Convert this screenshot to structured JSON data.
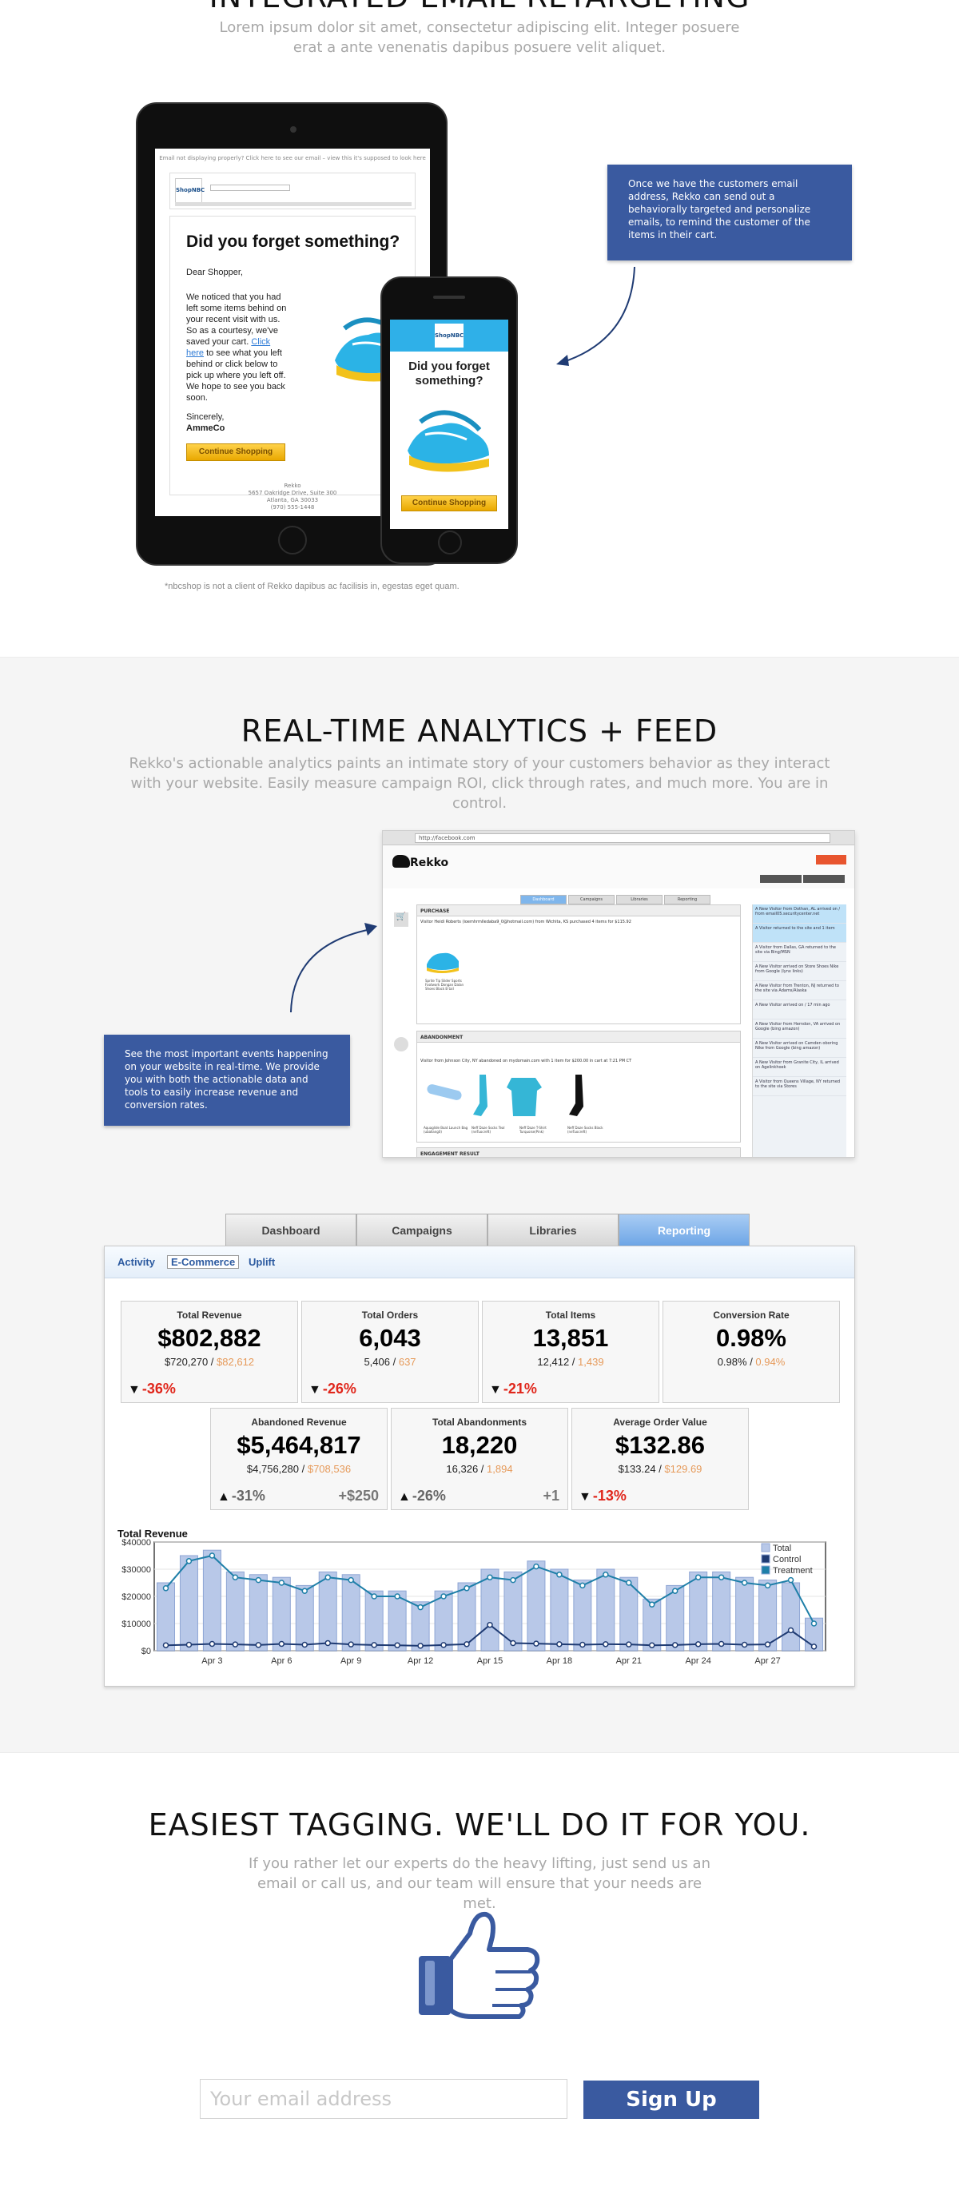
{
  "retargeting": {
    "title": "INTEGRATED EMAIL RETARGETING",
    "subtitle": "Lorem ipsum dolor sit amet, consectetur adipiscing elit. Integer posuere erat a ante venenatis dapibus posuere velit aliquet.",
    "callout": "Once we have the customers email address, Rekko can send out a behaviorally targeted and personalize emails, to remind the customer of the items in their cart.",
    "note": "*nbcshop is not a client of Rekko dapibus ac facilisis in, egestas eget quam.",
    "tablet": {
      "top_line": "Email not displaying properly? Click here to see our email – view this it's supposed to look here",
      "logo": "ShopNBC",
      "heading": "Did you forget something?",
      "greeting": "Dear Shopper,",
      "body_pre": "We noticed that you had left some items behind on your recent visit with us. So as a courtesy, we've saved your cart.",
      "link": "Click here",
      "body_post": "to see what you left behind or click below to pick up where you left off. We hope to see you back soon.",
      "sign_off": "Sincerely,",
      "signature": "AmmeCo",
      "button": "Continue Shopping",
      "footer_1": "Rekko",
      "footer_2": "5657 Oakridge Drive, Suite 300",
      "footer_3": "Atlanta, GA 30033",
      "footer_4": "(970) 555-1448"
    },
    "phone": {
      "logo": "ShopNBC",
      "heading": "Did you forget something?",
      "button": "Continue Shopping"
    }
  },
  "analytics": {
    "title": "REAL-TIME ANALYTICS + FEED",
    "subtitle": "Rekko's actionable analytics paints an intimate story of your customers behavior as they interact with your website. Easily measure campaign ROI, click through rates, and much more. You are in control.",
    "callout": "See the most important events happening on your website in real-time. We provide you with both the actionable data and tools to easily increase revenue and conversion rates.",
    "browser": {
      "url": "http://facebook.com",
      "brand": "Rekko",
      "tabs": [
        "Dashboard",
        "Campaigns",
        "Libraries",
        "Reporting"
      ],
      "panel_purchase": "PURCHASE",
      "panel_abandonment": "ABANDONMENT",
      "panel_engagement": "ENGAGEMENT RESULT",
      "purchase_line": "Visitor Heidi Roberts (ioemhrmlledaba9_0@hotmail.com) from Wichita, KS purchased 4 items for $115.92",
      "purchase_item": "Sprite Tip Slider Sports Footwork Dongan Dalan Shoes Black B tail",
      "abandon_line": "Visitor from Johnson City, NY abandoned on mydomain.com with 1 item for $200.00 in cart at 7:21 PM CT",
      "abandon_items": [
        "Aquaglide Boat Launch Bag (uballang0)",
        "Neff Daze Socks Teal (neTuocreft)",
        "Neff Daze T-Shirt Turquoise(Pink)",
        "Neff Daze Socks Black (neTuocreft)"
      ],
      "feed": [
        "A New Visitor from Dothan, AL arrived on / from email05.securitycenter.net",
        "A Visitor returned to the site and 1 item",
        "A Visitor from Dallas, GA returned to the site via Bing/MSN",
        "A New Visitor arrived on Store Shoes Nike from Google (lynx links)",
        "A New Visitor from Trenton, NJ returned to the site via Adams/Alaska",
        "A New Visitor arrived on / 17 min ago",
        "A New Visitor from Herndon, VA arrived on Google (bing amazon)",
        "A New Visitor arrived on Camden oboring Nike from Google (bing amazon)",
        "A New Visitor from Granite City, IL arrived on Agelinkhoek",
        "A Visitor from Queens Village, NY returned to the site via Stores"
      ]
    },
    "dashboard": {
      "tabs": [
        "Dashboard",
        "Campaigns",
        "Libraries",
        "Reporting"
      ],
      "subtabs": [
        "Activity",
        "E-Commerce",
        "Uplift"
      ],
      "kpis": [
        {
          "title": "Total Revenue",
          "value": "$802,882",
          "base": "$720,270",
          "comp": "$82,612",
          "delta": "-36%",
          "extra": ""
        },
        {
          "title": "Total Orders",
          "value": "6,043",
          "base": "5,406",
          "comp": "637",
          "delta": "-26%",
          "extra": ""
        },
        {
          "title": "Total Items",
          "value": "13,851",
          "base": "12,412",
          "comp": "1,439",
          "delta": "-21%",
          "extra": ""
        },
        {
          "title": "Conversion Rate",
          "value": "0.98%",
          "base": "0.98%",
          "comp": "0.94%",
          "delta": "",
          "extra": ""
        },
        {
          "title": "Abandoned Revenue",
          "value": "$5,464,817",
          "base": "$4,756,280",
          "comp": "$708,536",
          "delta": "-31%",
          "extra": "+$250"
        },
        {
          "title": "Total Abandonments",
          "value": "18,220",
          "base": "16,326",
          "comp": "1,894",
          "delta": "-26%",
          "extra": "+1"
        },
        {
          "title": "Average Order Value",
          "value": "$132.86",
          "base": "$133.24",
          "comp": "$129.69",
          "delta": "-13%",
          "extra": ""
        }
      ]
    }
  },
  "chart_data": {
    "type": "bar",
    "title": "Total Revenue",
    "categories": [
      "Apr 1",
      "Apr 2",
      "Apr 3",
      "Apr 4",
      "Apr 5",
      "Apr 6",
      "Apr 7",
      "Apr 8",
      "Apr 9",
      "Apr 10",
      "Apr 11",
      "Apr 12",
      "Apr 13",
      "Apr 14",
      "Apr 15",
      "Apr 16",
      "Apr 17",
      "Apr 18",
      "Apr 19",
      "Apr 20",
      "Apr 21",
      "Apr 22",
      "Apr 23",
      "Apr 24",
      "Apr 25",
      "Apr 26",
      "Apr 27",
      "Apr 28",
      "Apr 29"
    ],
    "tick_labels": [
      "Apr 3",
      "Apr 6",
      "Apr 9",
      "Apr 12",
      "Apr 15",
      "Apr 18",
      "Apr 21",
      "Apr 24",
      "Apr 27"
    ],
    "series": [
      {
        "name": "Total",
        "kind": "bar",
        "color": "#b8c8e8",
        "values": [
          25000,
          35000,
          37000,
          29000,
          28000,
          27000,
          24000,
          29000,
          28000,
          22000,
          22000,
          18000,
          22000,
          25000,
          30000,
          29000,
          33000,
          30000,
          26000,
          30000,
          27000,
          19000,
          24000,
          29000,
          29000,
          27000,
          26000,
          25000,
          12000
        ]
      },
      {
        "name": "Control",
        "kind": "line",
        "color": "#1f3b73",
        "values": [
          2000,
          2200,
          2500,
          2300,
          2100,
          2500,
          2200,
          2800,
          2300,
          2100,
          2000,
          1800,
          2100,
          2400,
          9500,
          2800,
          2600,
          2400,
          2200,
          2400,
          2300,
          2000,
          2100,
          2400,
          2500,
          2200,
          2300,
          7500,
          1500
        ]
      },
      {
        "name": "Treatment",
        "kind": "line",
        "color": "#1e7fa8",
        "values": [
          23000,
          33000,
          35000,
          27000,
          26000,
          25000,
          22000,
          27000,
          26000,
          20000,
          20000,
          16000,
          20000,
          23000,
          27000,
          26000,
          31000,
          28000,
          24000,
          28000,
          25000,
          17000,
          22000,
          27000,
          27000,
          25000,
          24000,
          26000,
          10000
        ]
      }
    ],
    "ylim": [
      0,
      40000
    ],
    "yticks": [
      "$0",
      "$10000",
      "$20000",
      "$30000",
      "$40000"
    ],
    "legend": "top-right"
  },
  "tagging": {
    "title": "EASIEST TAGGING. WE'LL DO IT FOR YOU.",
    "subtitle": "If you rather let our experts do the heavy lifting, just send us an email or call us, and our team will ensure that your needs are met.",
    "email_placeholder": "Your email address",
    "signup_label": "Sign Up",
    "icon": "thumbs-up-icon"
  }
}
